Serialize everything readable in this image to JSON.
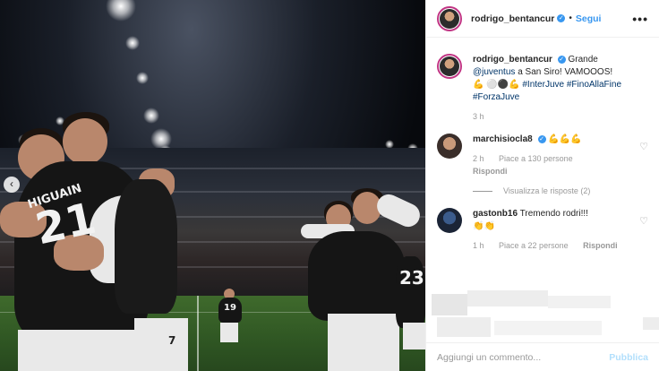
{
  "photo": {
    "alt_jersey_numbers": [
      "21",
      "7",
      "19",
      "23"
    ],
    "jersey_name": "HIGUAIN"
  },
  "header": {
    "username": "rodrigo_bentancur",
    "follow_label": "Segui",
    "more_icon": "more-horizontal-icon"
  },
  "caption": {
    "username": "rodrigo_bentancur",
    "text_prefix": "Grande",
    "mention": "@juventus",
    "text_mid": "a San Siro! VAMOOOS!",
    "emojis": "💪 ⚪⚫💪",
    "tags": [
      "#InterJuve",
      "#FinoAllaFine",
      "#ForzaJuve"
    ],
    "time": "3 h"
  },
  "comments": [
    {
      "username": "marchisiocla8",
      "verified": true,
      "text": "💪💪💪",
      "time": "2 h",
      "likes": "Piace a 130 persone",
      "reply": "Rispondi",
      "view_replies": "Visualizza le risposte (2)"
    },
    {
      "username": "gastonb16",
      "verified": false,
      "text": "Tremendo rodri!!!",
      "emoji_line": "👏👏",
      "time": "1 h",
      "likes": "Piace a 22 persone",
      "reply": "Rispondi"
    }
  ],
  "add_comment": {
    "placeholder": "Aggiungi un commento...",
    "post_label": "Pubblica"
  },
  "colors": {
    "link": "#003569",
    "accent_blue": "#3897f0",
    "post_disabled": "#b2dffc"
  }
}
